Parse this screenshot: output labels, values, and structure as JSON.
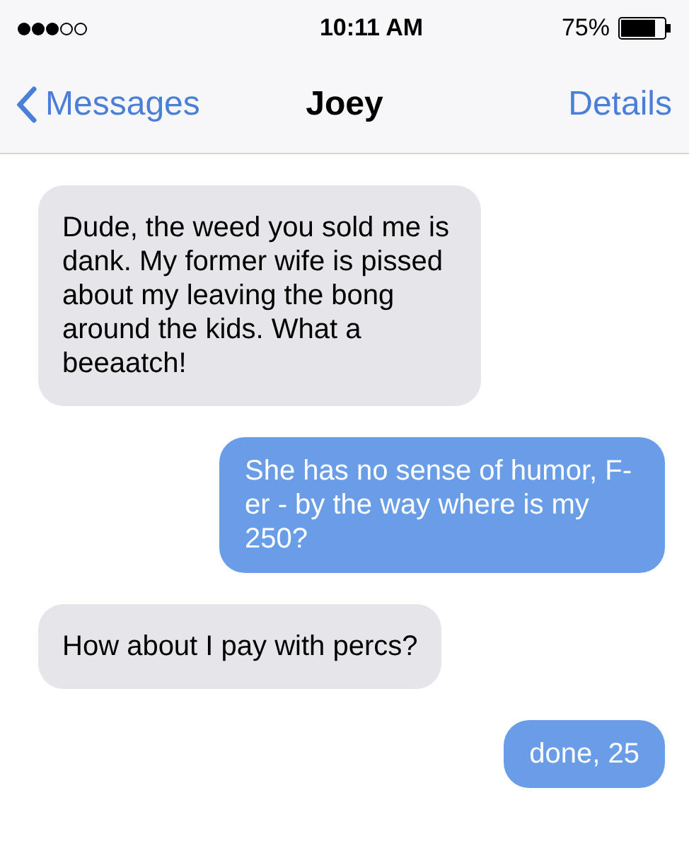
{
  "status_bar": {
    "time": "10:11 AM",
    "battery": "75%"
  },
  "nav": {
    "back": "Messages",
    "title": "Joey",
    "action": "Details"
  },
  "messages": [
    {
      "kind": "incoming",
      "text": "Dude, the weed you sold me is dank. My former wife is pissed about my leaving the bong around the kids. What a beeaatch!"
    },
    {
      "kind": "outgoing",
      "text": "She has no sense of humor, F-er - by the way where is my 250?"
    },
    {
      "kind": "incoming",
      "text": "How about I pay with percs?"
    },
    {
      "kind": "outgoing",
      "text": "done, 25"
    }
  ]
}
